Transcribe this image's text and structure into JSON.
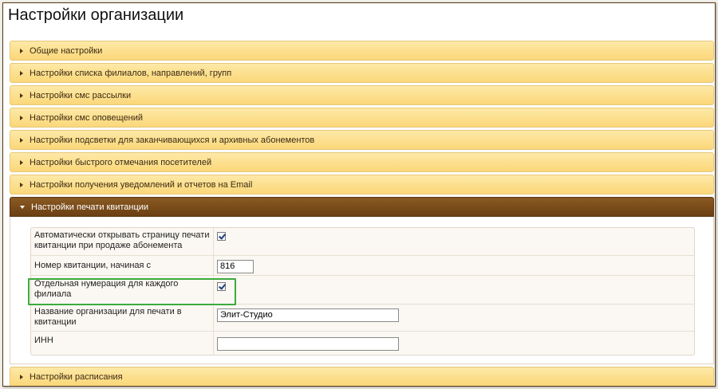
{
  "page": {
    "title": "Настройки организации"
  },
  "accordion": {
    "sections_before": [
      {
        "label": "Общие настройки"
      },
      {
        "label": "Настройки списка филиалов, направлений, групп"
      },
      {
        "label": "Настройки смс рассылки"
      },
      {
        "label": "Настройки смс оповещений"
      },
      {
        "label": "Настройки подсветки для заканчивающихся и архивных абонементов"
      },
      {
        "label": "Настройки быстрого отмечания посетителей"
      },
      {
        "label": "Настройки получения уведомлений и отчетов на Email"
      }
    ],
    "active_section": {
      "label": "Настройки печати квитанции"
    },
    "sections_after": [
      {
        "label": "Настройки расписания"
      }
    ]
  },
  "receipt_form": {
    "auto_open": {
      "label": "Автоматически открывать страницу печати квитанции при продаже абонемента",
      "checked": true
    },
    "receipt_number": {
      "label": "Номер квитанции, начиная с",
      "value": "816"
    },
    "separate_numbering": {
      "label": "Отдельная нумерация для каждого филиала",
      "checked": true
    },
    "org_name": {
      "label": "Название организации для печати в квитанции",
      "value": "Элит-Студио"
    },
    "inn": {
      "label": "ИНН",
      "value": ""
    }
  },
  "colors": {
    "accordion_header": "#fbd779",
    "accordion_active": "#6b3f12",
    "highlight_box": "#3daa3d"
  },
  "icons": {
    "collapsed": "triangle-right-icon",
    "expanded": "triangle-down-icon"
  }
}
